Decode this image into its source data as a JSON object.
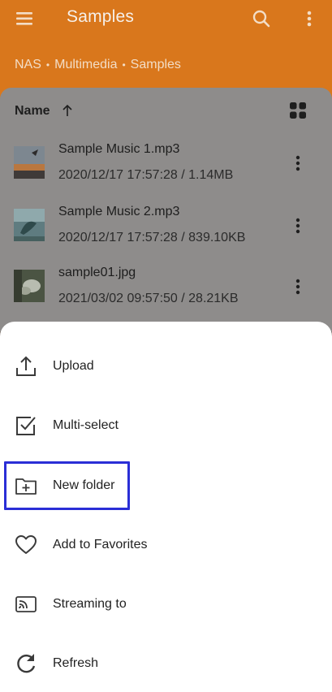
{
  "header": {
    "title": "Samples",
    "breadcrumb": [
      "NAS",
      "Multimedia",
      "Samples"
    ],
    "separator": "•"
  },
  "sort": {
    "label": "Name",
    "direction": "ascending"
  },
  "files": [
    {
      "name": "Sample Music 1.mp3",
      "meta": "2020/12/17 17:57:28 / 1.14MB"
    },
    {
      "name": "Sample Music 2.mp3",
      "meta": "2020/12/17 17:57:28 / 839.10KB"
    },
    {
      "name": "sample01.jpg",
      "meta": "2021/03/02 09:57:50 / 28.21KB"
    }
  ],
  "sheet": {
    "items": [
      {
        "label": "Upload",
        "icon": "upload-icon"
      },
      {
        "label": "Multi-select",
        "icon": "checkbox-icon"
      },
      {
        "label": "New folder",
        "icon": "new-folder-icon"
      },
      {
        "label": "Add to Favorites",
        "icon": "heart-icon"
      },
      {
        "label": "Streaming to",
        "icon": "cast-icon"
      },
      {
        "label": "Refresh",
        "icon": "refresh-icon"
      }
    ]
  },
  "colors": {
    "header": "#d9771c",
    "scrim_list": "#8e8c8b",
    "sheet": "#ffffff",
    "highlight": "#2a2ed6"
  }
}
